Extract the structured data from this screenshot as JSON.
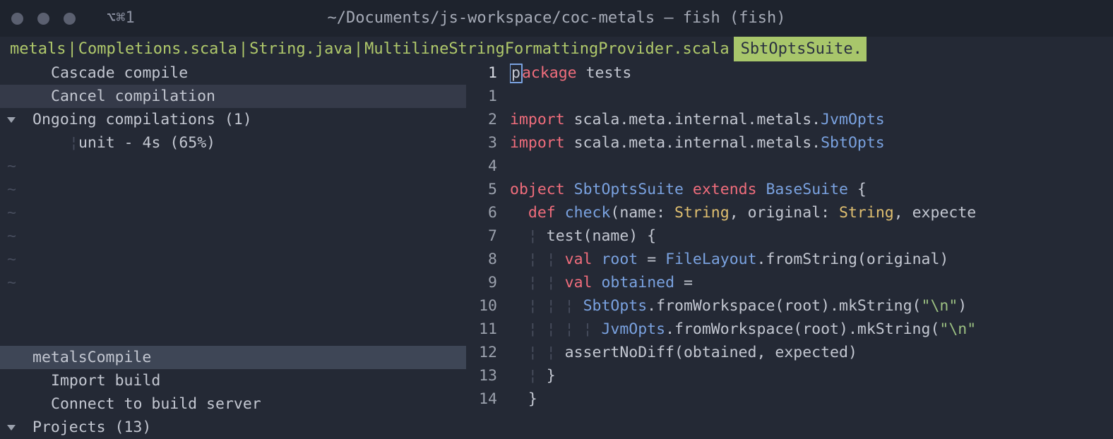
{
  "titlebar": {
    "window_label": "⌥⌘1",
    "path": "~/Documents/js-workspace/coc-metals — fish (fish)"
  },
  "tabs": {
    "items": [
      "metals",
      "Completions.scala",
      "String.java",
      "MultilineStringFormattingProvider.scala"
    ],
    "active": "SbtOptsSuite."
  },
  "sidebar_top": {
    "rows": [
      {
        "text": "Cascade compile",
        "indent": 1,
        "highlight": false,
        "chev": false
      },
      {
        "text": "Cancel compilation",
        "indent": 1,
        "highlight": true,
        "chev": false
      },
      {
        "text": "Ongoing compilations (1)",
        "indent": 0,
        "highlight": false,
        "chev": true
      },
      {
        "text": "unit - 4s (65%)",
        "indent": 2,
        "highlight": false,
        "chev": false,
        "tick": true
      }
    ]
  },
  "sidebar_bottom": {
    "rows": [
      {
        "text": "metalsCompile",
        "indent": 0,
        "style": "selected",
        "chev": false
      },
      {
        "text": "Import build",
        "indent": 1,
        "style": "",
        "chev": false
      },
      {
        "text": "Connect to build server",
        "indent": 1,
        "style": "",
        "chev": false
      },
      {
        "text": "Projects (13)",
        "indent": 0,
        "style": "",
        "chev": true
      }
    ]
  },
  "editor": {
    "lines": [
      {
        "n": "1",
        "current": true,
        "tokens": [
          {
            "c": "kw-red",
            "t": ""
          },
          {
            "cursor": "p"
          },
          {
            "c": "kw-red",
            "t": "ackage"
          },
          {
            "c": "plain",
            "t": " tests"
          }
        ]
      },
      {
        "n": "1",
        "tokens": []
      },
      {
        "n": "2",
        "tokens": [
          {
            "c": "kw-red",
            "t": "import"
          },
          {
            "c": "plain",
            "t": " scala.meta.internal.metals."
          },
          {
            "c": "kw-blue",
            "t": "JvmOpts"
          }
        ]
      },
      {
        "n": "3",
        "tokens": [
          {
            "c": "kw-red",
            "t": "import"
          },
          {
            "c": "plain",
            "t": " scala.meta.internal.metals."
          },
          {
            "c": "kw-blue",
            "t": "SbtOpts"
          }
        ]
      },
      {
        "n": "4",
        "tokens": []
      },
      {
        "n": "5",
        "tokens": [
          {
            "c": "kw-red",
            "t": "object"
          },
          {
            "c": "plain",
            "t": " "
          },
          {
            "c": "kw-blue",
            "t": "SbtOptsSuite"
          },
          {
            "c": "plain",
            "t": " "
          },
          {
            "c": "kw-red",
            "t": "extends"
          },
          {
            "c": "plain",
            "t": " "
          },
          {
            "c": "kw-blue",
            "t": "BaseSuite"
          },
          {
            "c": "plain",
            "t": " {"
          }
        ]
      },
      {
        "n": "6",
        "tokens": [
          {
            "c": "plain",
            "t": "  "
          },
          {
            "c": "kw-red",
            "t": "def"
          },
          {
            "c": "plain",
            "t": " "
          },
          {
            "c": "kw-blue",
            "t": "check"
          },
          {
            "c": "plain",
            "t": "(name: "
          },
          {
            "c": "ty",
            "t": "String"
          },
          {
            "c": "plain",
            "t": ", original: "
          },
          {
            "c": "ty",
            "t": "String"
          },
          {
            "c": "plain",
            "t": ", expecte"
          }
        ]
      },
      {
        "n": "7",
        "tokens": [
          {
            "c": "guide",
            "t": "  ¦ "
          },
          {
            "c": "plain",
            "t": "test(name) {"
          }
        ]
      },
      {
        "n": "8",
        "tokens": [
          {
            "c": "guide",
            "t": "  ¦ ¦ "
          },
          {
            "c": "kw-red",
            "t": "val"
          },
          {
            "c": "plain",
            "t": " "
          },
          {
            "c": "kw-blue",
            "t": "root"
          },
          {
            "c": "plain",
            "t": " = "
          },
          {
            "c": "kw-blue",
            "t": "FileLayout"
          },
          {
            "c": "plain",
            "t": ".fromString(original)"
          }
        ]
      },
      {
        "n": "9",
        "tokens": [
          {
            "c": "guide",
            "t": "  ¦ ¦ "
          },
          {
            "c": "kw-red",
            "t": "val"
          },
          {
            "c": "plain",
            "t": " "
          },
          {
            "c": "kw-blue",
            "t": "obtained"
          },
          {
            "c": "plain",
            "t": " ="
          }
        ]
      },
      {
        "n": "10",
        "tokens": [
          {
            "c": "guide",
            "t": "  ¦ ¦ ¦ "
          },
          {
            "c": "kw-blue",
            "t": "SbtOpts"
          },
          {
            "c": "plain",
            "t": ".fromWorkspace(root).mkString("
          },
          {
            "c": "str",
            "t": "\"\\n\""
          },
          {
            "c": "plain",
            "t": ")"
          }
        ]
      },
      {
        "n": "11",
        "tokens": [
          {
            "c": "guide",
            "t": "  ¦ ¦ ¦ ¦ "
          },
          {
            "c": "kw-blue",
            "t": "JvmOpts"
          },
          {
            "c": "plain",
            "t": ".fromWorkspace(root).mkString("
          },
          {
            "c": "str",
            "t": "\"\\n\""
          }
        ]
      },
      {
        "n": "12",
        "tokens": [
          {
            "c": "guide",
            "t": "  ¦ ¦ "
          },
          {
            "c": "plain",
            "t": "assertNoDiff(obtained, expected)"
          }
        ]
      },
      {
        "n": "13",
        "tokens": [
          {
            "c": "guide",
            "t": "  ¦ "
          },
          {
            "c": "plain",
            "t": "}"
          }
        ]
      },
      {
        "n": "14",
        "tokens": [
          {
            "c": "plain",
            "t": "  }"
          }
        ]
      }
    ]
  }
}
